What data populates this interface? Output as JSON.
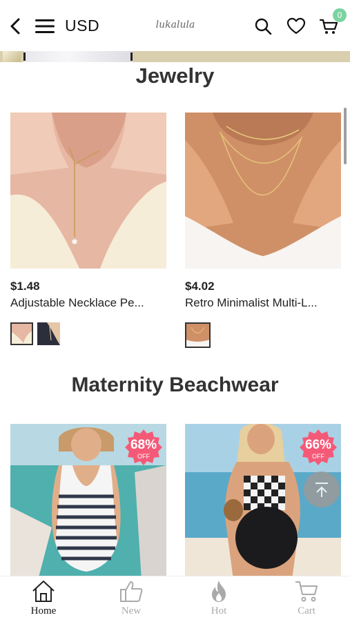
{
  "header": {
    "currency": "USD",
    "logo_text": "lukalula",
    "cart_count": "0"
  },
  "sections": [
    {
      "title": "Jewelry",
      "products": [
        {
          "price": "$1.48",
          "name": "Adjustable Necklace Pe...",
          "swatch_count": 2
        },
        {
          "price": "$4.02",
          "name": "Retro Minimalist Multi-L...",
          "swatch_count": 1
        }
      ]
    },
    {
      "title": "Maternity Beachwear",
      "products": [
        {
          "discount": "68%",
          "discount_label": "OFF"
        },
        {
          "discount": "66%",
          "discount_label": "OFF"
        }
      ]
    }
  ],
  "bottom_nav": [
    {
      "label": "Home",
      "icon": "home-icon",
      "active": true
    },
    {
      "label": "New",
      "icon": "thumbs-up-icon",
      "active": false
    },
    {
      "label": "Hot",
      "icon": "flame-icon",
      "active": false
    },
    {
      "label": "Cart",
      "icon": "cart-icon",
      "active": false
    }
  ],
  "colors": {
    "badge": "#f45a78",
    "cart_badge": "#7bd3a0",
    "banner": "#d9cfae"
  }
}
